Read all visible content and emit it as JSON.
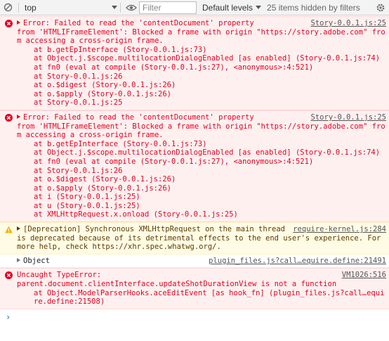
{
  "toolbar": {
    "context_value": "top",
    "filter_placeholder": "Filter",
    "levels_label": "Default levels",
    "hidden_text": "25 items hidden by filters"
  },
  "colors": {
    "error": "#e6001e",
    "warning_bg": "#fffbe5",
    "error_bg": "#fff0f0",
    "prompt": "#367cf1"
  },
  "messages": [
    {
      "level": "error",
      "source": "Story-0.0.1.js:25",
      "lines": [
        "Error: Failed to read the 'contentDocument' property",
        "from 'HTMLIFrameElement': Blocked a frame with origin \"https://story.adobe.com\" from accessing a cross-origin frame.",
        "at b.getEpInterface (Story-0.0.1.js:73)",
        "at Object.j.$scope.multilocationDialogEnabled [as enabled] (Story-0.0.1.js:74)",
        "at fn0 (eval at compile (Story-0.0.1.js:27), <anonymous>:4:521)",
        "at Story-0.0.1.js:26",
        "at o.$digest (Story-0.0.1.js:26)",
        "at o.$apply (Story-0.0.1.js:26)",
        "at Story-0.0.1.js:25"
      ]
    },
    {
      "level": "error",
      "source": "Story-0.0.1.js:25",
      "lines": [
        "Error: Failed to read the 'contentDocument' property",
        "from 'HTMLIFrameElement': Blocked a frame with origin \"https://story.adobe.com\" from accessing a cross-origin frame.",
        "at b.getEpInterface (Story-0.0.1.js:73)",
        "at Object.j.$scope.multilocationDialogEnabled [as enabled] (Story-0.0.1.js:74)",
        "at fn0 (eval at compile (Story-0.0.1.js:27), <anonymous>:4:521)",
        "at Story-0.0.1.js:26",
        "at o.$digest (Story-0.0.1.js:26)",
        "at o.$apply (Story-0.0.1.js:26)",
        "at i (Story-0.0.1.js:25)",
        "at u (Story-0.0.1.js:25)",
        "at XMLHttpRequest.x.onload (Story-0.0.1.js:25)"
      ]
    },
    {
      "level": "warning",
      "source": "require-kernel.js:284",
      "text": "[Deprecation] Synchronous XMLHttpRequest on the main thread is deprecated because of its detrimental effects to the end user's experience. For more help, check https://xhr.spec.whatwg.org/."
    },
    {
      "level": "log",
      "source": "plugin_files.js?call…equire.define:21491",
      "text": "Object"
    },
    {
      "level": "error",
      "source": "VM1026:516",
      "lines": [
        "Uncaught TypeError:",
        "parent.document.clientInterface.updateShotDurationView is not a function",
        "at Object.ModelParserHooks.aceEditEvent [as hook_fn] (plugin_files.js?call…equire.define:21508)"
      ]
    }
  ]
}
